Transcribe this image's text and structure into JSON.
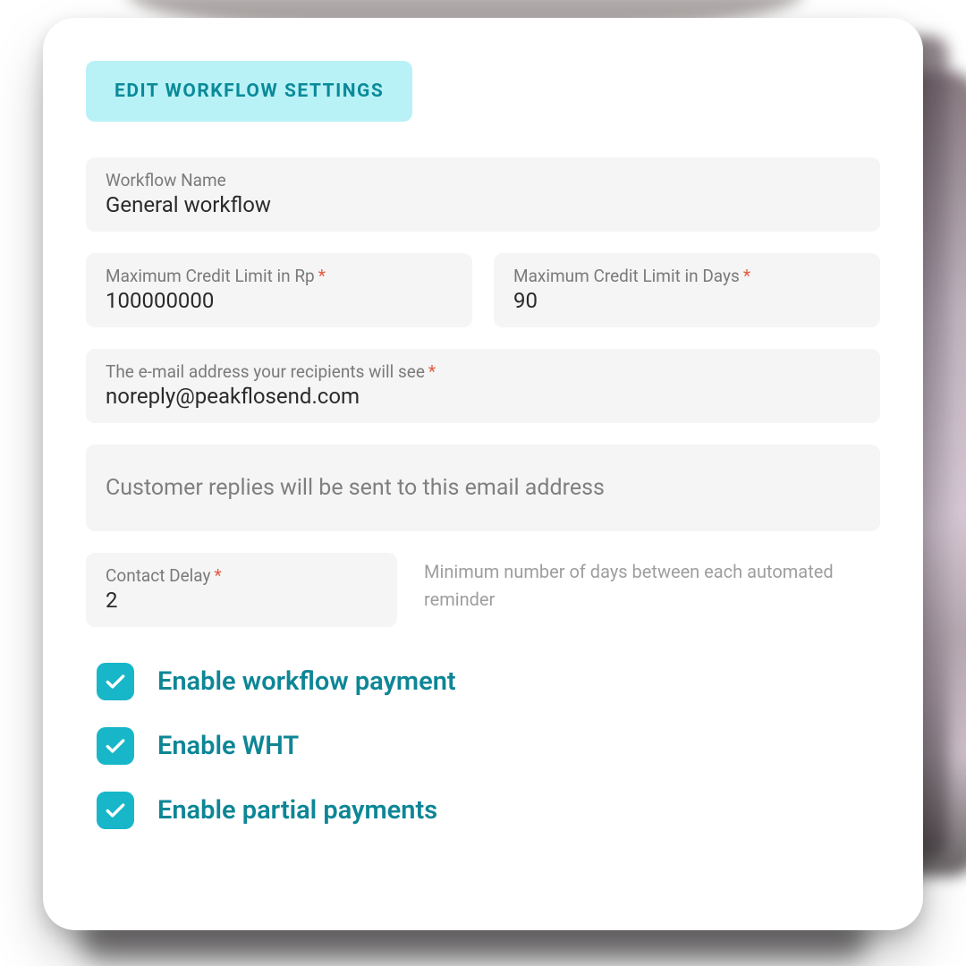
{
  "header": {
    "title": "EDIT WORKFLOW SETTINGS"
  },
  "fields": {
    "workflow_name": {
      "label": "Workflow Name",
      "value": "General workflow"
    },
    "credit_limit_rp": {
      "label": "Maximum Credit Limit in Rp",
      "value": "100000000"
    },
    "credit_limit_days": {
      "label": "Maximum Credit Limit in Days",
      "value": "90"
    },
    "from_email": {
      "label": "The e-mail address your recipients will see",
      "value": "noreply@peakflosend.com"
    },
    "reply_email": {
      "placeholder": "Customer replies will be sent to this email address"
    },
    "contact_delay": {
      "label": "Contact Delay",
      "value": "2",
      "help": "Minimum number of days between each automated reminder"
    }
  },
  "toggles": {
    "workflow_payment": {
      "label": "Enable workflow payment",
      "checked": true
    },
    "wht": {
      "label": "Enable WHT",
      "checked": true
    },
    "partial_payments": {
      "label": "Enable partial payments",
      "checked": true
    }
  },
  "required_mark": "*"
}
